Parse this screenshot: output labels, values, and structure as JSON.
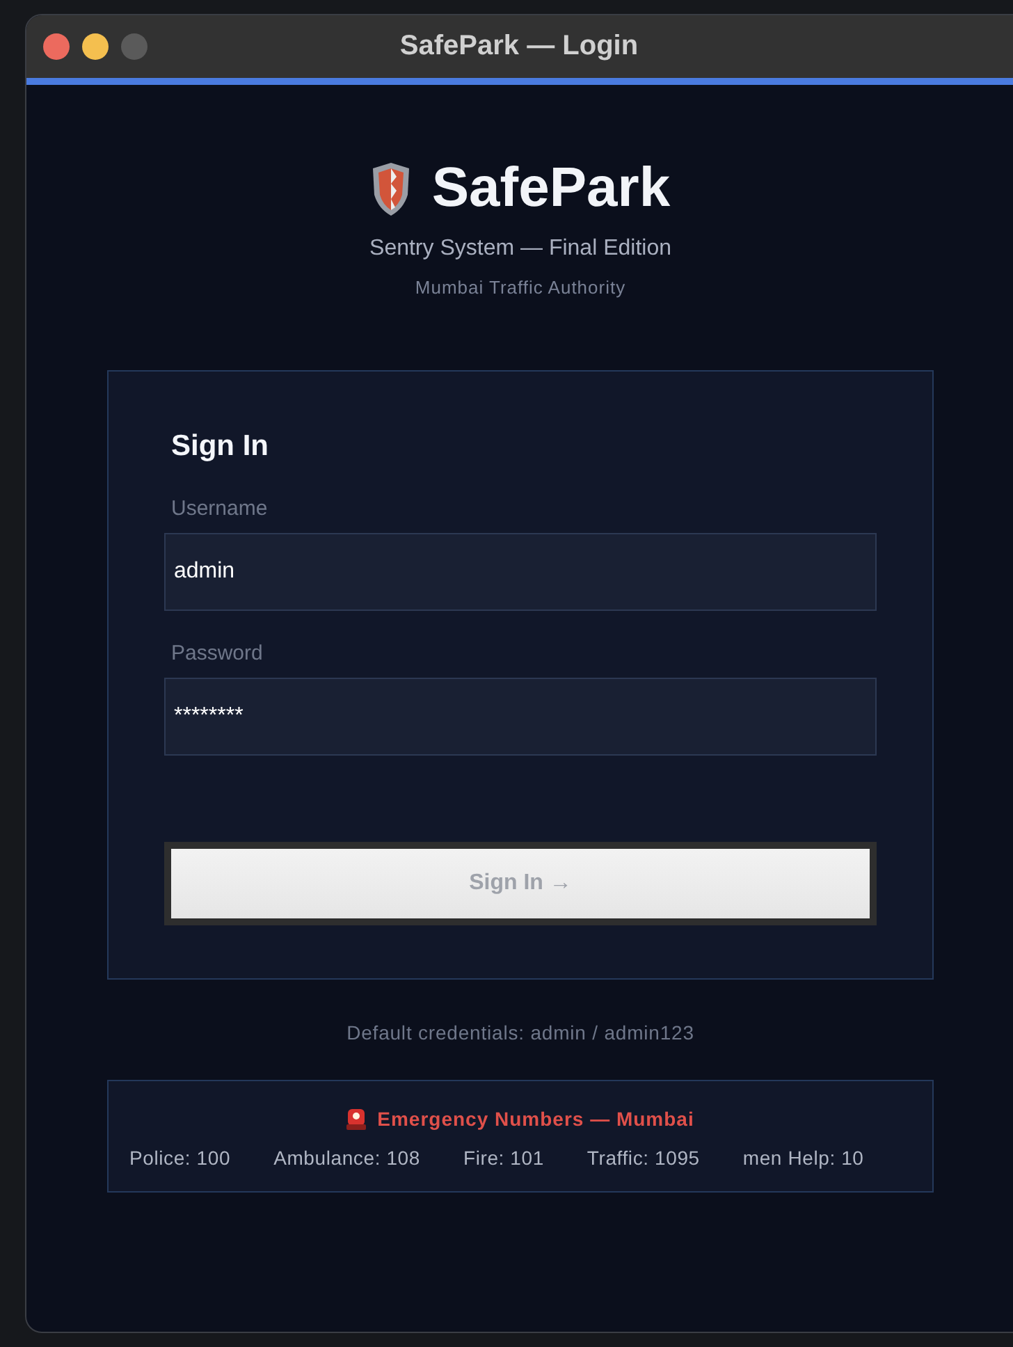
{
  "window": {
    "title": "SafePark — Login"
  },
  "brand": {
    "name": "SafePark",
    "subtitle": "Sentry System — Final Edition",
    "tagline": "Mumbai Traffic Authority"
  },
  "sign_in": {
    "heading": "Sign In",
    "fields": [
      {
        "label": "Username",
        "value": "admin"
      },
      {
        "label": "Password",
        "value": "********"
      }
    ],
    "button": "Sign In →"
  },
  "hint": "Default credentials: admin / admin123",
  "emergency": {
    "title": "Emergency Numbers — Mumbai",
    "items": [
      "Police: 100",
      "Ambulance: 108",
      "Fire: 101",
      "Traffic: 1095",
      "men Help: 10"
    ]
  }
}
